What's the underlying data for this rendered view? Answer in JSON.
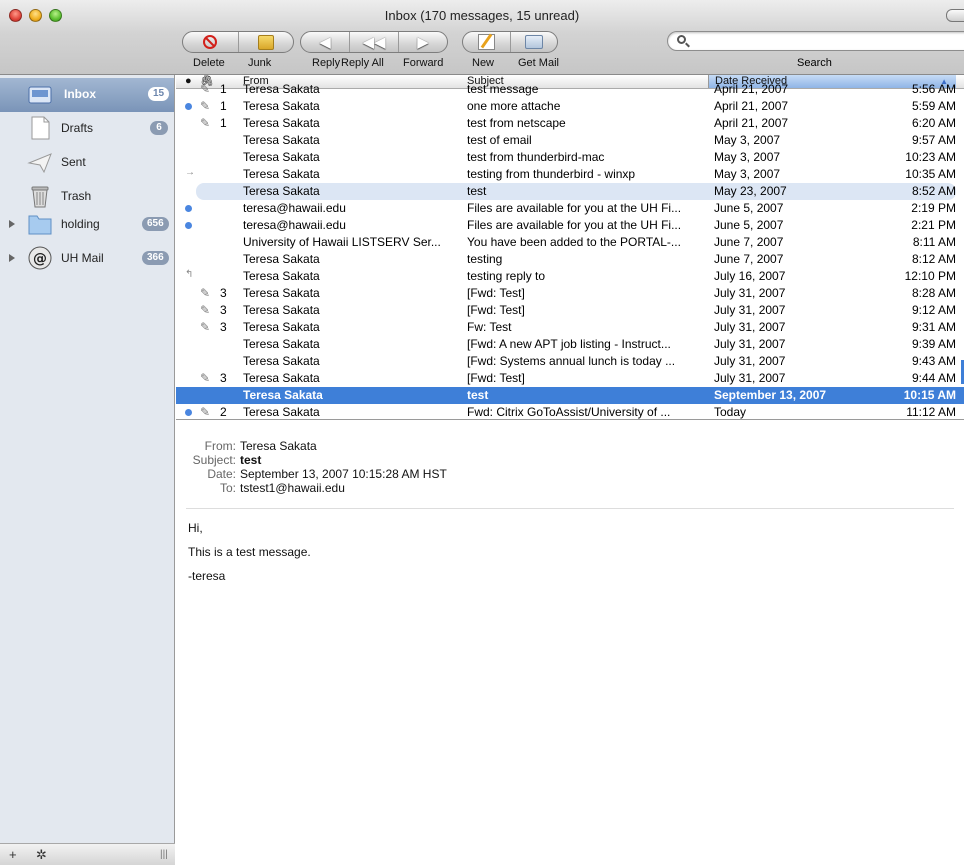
{
  "window": {
    "title": "Inbox (170 messages, 15 unread)"
  },
  "toolbar": {
    "delete": "Delete",
    "junk": "Junk",
    "reply": "Reply",
    "reply_all": "Reply All",
    "forward": "Forward",
    "new": "New",
    "get_mail": "Get Mail",
    "search": "Search",
    "search_placeholder": ""
  },
  "sidebar": {
    "items": [
      {
        "label": "Inbox",
        "badge": "15",
        "icon": "inbox-icon",
        "selected": true
      },
      {
        "label": "Drafts",
        "badge": "6",
        "icon": "drafts-icon"
      },
      {
        "label": "Sent",
        "badge": "",
        "icon": "sent-icon"
      },
      {
        "label": "Trash",
        "badge": "",
        "icon": "trash-icon"
      },
      {
        "label": "holding",
        "badge": "656",
        "icon": "folder-icon"
      },
      {
        "label": "UH Mail",
        "badge": "366",
        "icon": "mail-account-icon"
      }
    ],
    "bottom": {
      "add": "+",
      "action": "✲",
      "resize": "|||"
    }
  },
  "list": {
    "columns": {
      "unread": "●",
      "attach": "🖇",
      "from": "From",
      "subject": "Subject",
      "date": "Date Received"
    },
    "rows": [
      {
        "unread": false,
        "attach": "✎",
        "thread": "1",
        "from": "Teresa Sakata",
        "subject": "test message",
        "date": "April 21, 2007",
        "time": "5:56 AM"
      },
      {
        "unread": true,
        "attach": "✎",
        "thread": "1",
        "from": "Teresa Sakata",
        "subject": "one more attache",
        "date": "April 21, 2007",
        "time": "5:59 AM"
      },
      {
        "unread": false,
        "attach": "✎",
        "thread": "1",
        "from": "Teresa Sakata",
        "subject": "test from netscape",
        "date": "April 21, 2007",
        "time": "6:20 AM"
      },
      {
        "unread": false,
        "attach": "",
        "thread": "",
        "from": "Teresa Sakata",
        "subject": "test of email",
        "date": "May 3, 2007",
        "time": "9:57 AM"
      },
      {
        "unread": false,
        "attach": "",
        "thread": "",
        "from": "Teresa Sakata",
        "subject": "test from thunderbird-mac",
        "date": "May 3, 2007",
        "time": "10:23 AM"
      },
      {
        "unread": false,
        "mark": "→",
        "attach": "",
        "thread": "",
        "from": "Teresa Sakata",
        "subject": "testing from thunderbird - winxp",
        "date": "May 3, 2007",
        "time": "10:35 AM"
      },
      {
        "unread": false,
        "attach": "",
        "thread": "",
        "from": "Teresa Sakata",
        "subject": "test",
        "date": "May 23, 2007",
        "time": "8:52 AM",
        "highlight": true
      },
      {
        "unread": true,
        "attach": "",
        "thread": "",
        "from": "teresa@hawaii.edu",
        "subject": "Files are available for you at the UH Fi...",
        "date": "June 5, 2007",
        "time": "2:19 PM"
      },
      {
        "unread": true,
        "attach": "",
        "thread": "",
        "from": "teresa@hawaii.edu",
        "subject": "Files are available for you at the UH Fi...",
        "date": "June 5, 2007",
        "time": "2:21 PM"
      },
      {
        "unread": false,
        "attach": "",
        "thread": "",
        "from": "University of Hawaii LISTSERV Ser...",
        "subject": "You have been added to the PORTAL-...",
        "date": "June 7, 2007",
        "time": "8:11 AM"
      },
      {
        "unread": false,
        "attach": "",
        "thread": "",
        "from": "Teresa Sakata",
        "subject": "testing",
        "date": "June 7, 2007",
        "time": "8:12 AM"
      },
      {
        "unread": false,
        "mark": "↰",
        "attach": "",
        "thread": "",
        "from": "Teresa Sakata",
        "subject": "testing reply to",
        "date": "July 16, 2007",
        "time": "12:10 PM"
      },
      {
        "unread": false,
        "attach": "✎",
        "thread": "3",
        "from": "Teresa Sakata",
        "subject": "[Fwd: Test]",
        "date": "July 31, 2007",
        "time": "8:28 AM"
      },
      {
        "unread": false,
        "attach": "✎",
        "thread": "3",
        "from": "Teresa Sakata",
        "subject": "[Fwd: Test]",
        "date": "July 31, 2007",
        "time": "9:12 AM"
      },
      {
        "unread": false,
        "attach": "✎",
        "thread": "3",
        "from": "Teresa Sakata",
        "subject": "Fw: Test",
        "date": "July 31, 2007",
        "time": "9:31 AM"
      },
      {
        "unread": false,
        "attach": "",
        "thread": "",
        "from": "Teresa Sakata",
        "subject": "[Fwd: A new APT job listing - Instruct...",
        "date": "July 31, 2007",
        "time": "9:39 AM"
      },
      {
        "unread": false,
        "attach": "",
        "thread": "",
        "from": "Teresa Sakata",
        "subject": "[Fwd: Systems annual lunch is today ...",
        "date": "July 31, 2007",
        "time": "9:43 AM"
      },
      {
        "unread": false,
        "attach": "✎",
        "thread": "3",
        "from": "Teresa Sakata",
        "subject": "[Fwd: Test]",
        "date": "July 31, 2007",
        "time": "9:44 AM"
      },
      {
        "unread": false,
        "attach": "",
        "thread": "",
        "from": "Teresa Sakata",
        "subject": "test",
        "date": "September 13, 2007",
        "time": "10:15 AM",
        "selected": true
      },
      {
        "unread": true,
        "attach": "✎",
        "thread": "2",
        "from": "Teresa Sakata",
        "subject": "Fwd: Citrix GoToAssist/University of ...",
        "date": "Today",
        "time": "11:12 AM"
      }
    ]
  },
  "preview": {
    "from_k": "From:",
    "from_v": "Teresa Sakata",
    "subject_k": "Subject:",
    "subject_v": "test",
    "date_k": "Date:",
    "date_v": "September 13, 2007 10:15:28 AM HST",
    "to_k": "To:",
    "to_v": "tstest1@hawaii.edu",
    "body": [
      "Hi,",
      "This is a test message.",
      "-teresa"
    ]
  },
  "colors": {
    "selection": "#3e7fd8",
    "sidebar": "#e3e8ef",
    "unread_dot": "#4a86e0"
  }
}
